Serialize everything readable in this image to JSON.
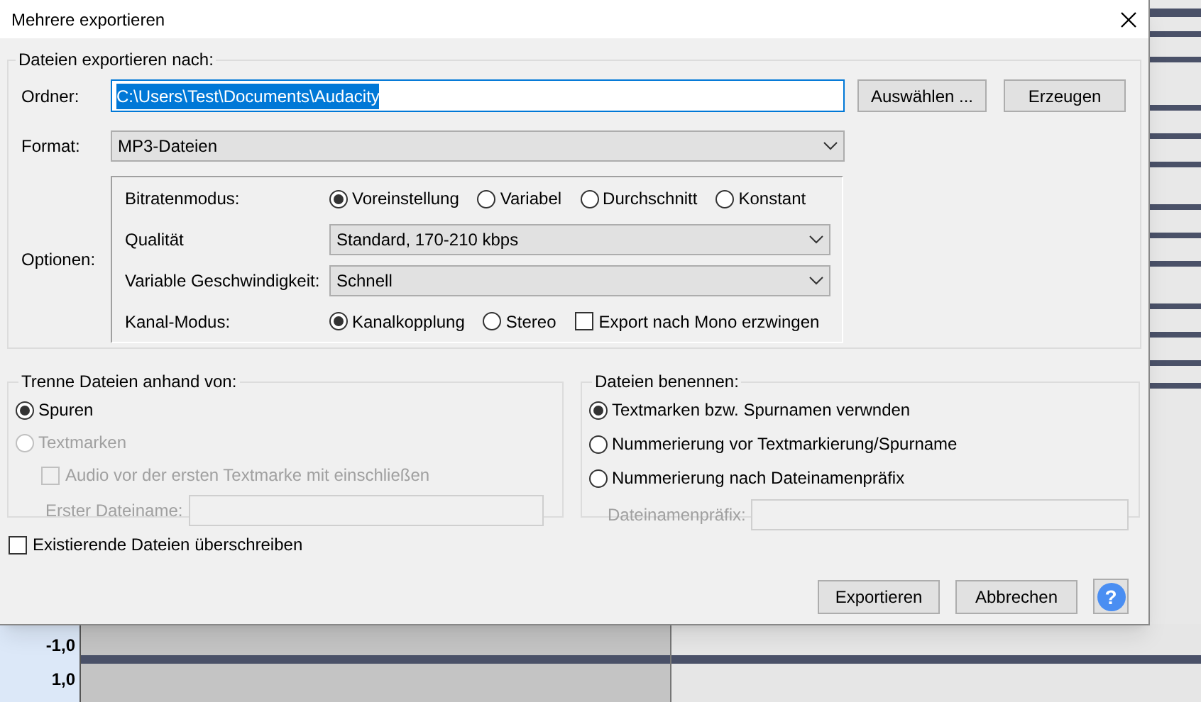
{
  "window": {
    "title": "Mehrere exportieren"
  },
  "export_to": {
    "legend": "Dateien exportieren nach:",
    "folder": {
      "label": "Ordner:",
      "value": "C:\\Users\\Test\\Documents\\Audacity",
      "selected": true
    },
    "buttons": [
      "Auswählen ...",
      "Erzeugen"
    ],
    "format": {
      "label": "Format:",
      "value": "MP3-Dateien"
    },
    "options": {
      "label": "Optionen:",
      "rows": [
        {
          "kind": "radios",
          "label": "Bitratenmodus:",
          "choices": [
            {
              "label": "Voreinstellung",
              "selected": true
            },
            {
              "label": "Variabel",
              "selected": false
            },
            {
              "label": "Durchschnitt",
              "selected": false
            },
            {
              "label": "Konstant",
              "selected": false
            }
          ]
        },
        {
          "kind": "select",
          "label": "Qualität",
          "value": "Standard, 170-210 kbps"
        },
        {
          "kind": "select",
          "label": "Variable Geschwindigkeit:",
          "value": "Schnell"
        },
        {
          "kind": "radios",
          "label": "Kanal-Modus:",
          "choices": [
            {
              "label": "Kanalkopplung",
              "selected": true
            },
            {
              "label": "Stereo",
              "selected": false
            }
          ],
          "checkbox": {
            "label": "Export nach Mono erzwingen",
            "checked": false
          }
        }
      ]
    }
  },
  "split": {
    "legend": "Trenne Dateien anhand von:",
    "choices": [
      {
        "label": "Spuren",
        "selected": true,
        "disabled": false
      },
      {
        "label": "Textmarken",
        "selected": false,
        "disabled": true
      }
    ],
    "include_audio": {
      "label": "Audio vor der ersten Textmarke mit einschließen",
      "checked": false,
      "disabled": true
    },
    "first_name": {
      "label": "Erster Dateiname:",
      "disabled": true
    }
  },
  "naming": {
    "legend": "Dateien benennen:",
    "choices": [
      {
        "label": "Textmarken bzw. Spurnamen verwnden",
        "selected": true
      },
      {
        "label": "Nummerierung vor Textmarkierung/Spurname",
        "selected": false
      },
      {
        "label": "Nummerierung nach Dateinamenpräfix",
        "selected": false
      }
    ],
    "prefix": {
      "label": "Dateinamenpräfix:",
      "disabled": true
    }
  },
  "overwrite": {
    "label": "Existierende Dateien überschreiben",
    "checked": false
  },
  "footer_buttons": [
    "Exportieren",
    "Abbrechen"
  ],
  "help_button": "?",
  "background": {
    "scale_labels": [
      "-1,0",
      "1,0"
    ]
  }
}
